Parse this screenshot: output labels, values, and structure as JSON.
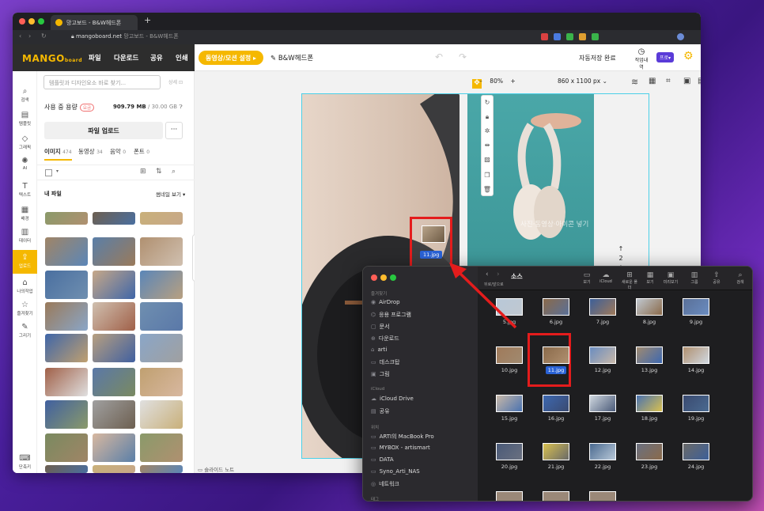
{
  "browser": {
    "tab_title": "망고보드 - B&W헤드폰",
    "new_tab": "+",
    "url_domain": "mangoboard.net",
    "url_title": "망고보드 - B&W헤드폰"
  },
  "app": {
    "logo": "MANGO",
    "logo_sub": "board",
    "menu": [
      "파일",
      "다운로드",
      "공유",
      "인쇄"
    ],
    "video_button": "동영상/모션 설정 ▸",
    "doc_title": "B&W헤드폰",
    "autosave": "자동저장 완료",
    "history": "작업내역",
    "pro": "프로▾"
  },
  "sidenav": [
    {
      "icon": "search-icon",
      "glyph": "⌕",
      "label": "검색"
    },
    {
      "icon": "template-icon",
      "glyph": "▤",
      "label": "템플릿"
    },
    {
      "icon": "graphic-icon",
      "glyph": "◇",
      "label": "그래픽"
    },
    {
      "icon": "ai-icon",
      "glyph": "✺",
      "label": "AI"
    },
    {
      "icon": "text-icon",
      "glyph": "T",
      "label": "텍스트"
    },
    {
      "icon": "background-icon",
      "glyph": "▦",
      "label": "배경"
    },
    {
      "icon": "data-icon",
      "glyph": "▥",
      "label": "데이터"
    },
    {
      "icon": "upload-icon",
      "glyph": "⇪",
      "label": "업로드"
    },
    {
      "icon": "mywork-icon",
      "glyph": "⌂",
      "label": "나의작업"
    },
    {
      "icon": "favorite-icon",
      "glyph": "☆",
      "label": "즐겨찾기"
    },
    {
      "icon": "draw-icon",
      "glyph": "✎",
      "label": "그리기"
    }
  ],
  "sidenav_bottom": "단축키",
  "panel": {
    "search_placeholder": "템플릿과 디자인요소 바로 찾기...",
    "size_label": "상세 ⊡",
    "usage_label": "사용 중 용량",
    "usage_badge": "요금",
    "usage_value": "909.79 MB",
    "usage_total": " / 30.00 GB",
    "upload_button": "파일 업로드",
    "more_button": "···",
    "tabs": [
      {
        "label": "이미지",
        "count": "474"
      },
      {
        "label": "동영상",
        "count": "34"
      },
      {
        "label": "음악",
        "count": "0"
      },
      {
        "label": "폰트",
        "count": "0"
      }
    ],
    "myfiles": "내 파일",
    "thumbview": "썸네일 보기 ▾",
    "collapse": "‹ ›"
  },
  "canvas": {
    "zoom": "80%",
    "page_size": "860 x 1100 px ⌄",
    "drag_file": "11.jpg",
    "place_hint": "사진·동영상·아이콘 넣기",
    "page_up": "↑",
    "page_number": "2",
    "page_down": "↓",
    "slide_note": "슬라이드 노트"
  },
  "finder": {
    "back_label": "뒤로/앞으로",
    "folder_title": "소스",
    "toolbar": [
      "보기",
      "iCloud",
      "새로운 폴더",
      "보기",
      "미리보기",
      "그룹",
      "공유",
      "검색"
    ],
    "sections": {
      "favorites": "즐겨찾기",
      "icloud": "iCloud",
      "locations": "위치",
      "tags": "태그"
    },
    "favorites": [
      "AirDrop",
      "응용 프로그램",
      "문서",
      "다운로드",
      "arti",
      "데스크탑",
      "그림"
    ],
    "icloud_items": [
      "iCloud Drive",
      "공유"
    ],
    "locations": [
      "ARTI의 MacBook Pro",
      "MYBOX - artismart",
      "DATA",
      "Syno_Arti_NAS",
      "네트워크"
    ],
    "files": [
      "5.jpg",
      "6.jpg",
      "7.jpg",
      "8.jpg",
      "9.jpg",
      "10.jpg",
      "11.jpg",
      "12.jpg",
      "13.jpg",
      "14.jpg",
      "15.jpg",
      "16.jpg",
      "17.jpg",
      "18.jpg",
      "19.jpg",
      "20.jpg",
      "21.jpg",
      "22.jpg",
      "23.jpg",
      "24.jpg"
    ],
    "selected": "11.jpg"
  },
  "colors": {
    "accent": "#f5b800",
    "highlight": "#e41c1c",
    "selection": "#2a62d6"
  }
}
